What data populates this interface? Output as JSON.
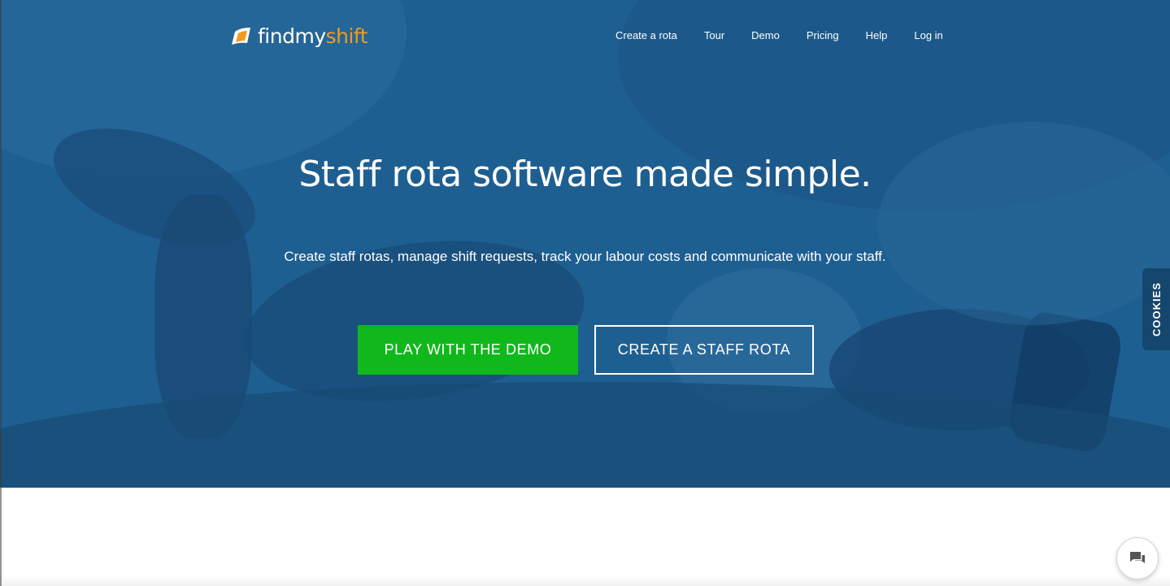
{
  "brand": {
    "name_part1": "findmy",
    "name_part2": "shift",
    "icon": "findmyshift-logo-icon",
    "colors": {
      "primary": "#ffffff",
      "accent": "#f39a1e"
    }
  },
  "nav": {
    "items": [
      {
        "label": "Create a rota"
      },
      {
        "label": "Tour"
      },
      {
        "label": "Demo"
      },
      {
        "label": "Pricing"
      },
      {
        "label": "Help"
      },
      {
        "label": "Log in"
      }
    ]
  },
  "hero": {
    "title": "Staff rota software made simple.",
    "subtitle": "Create staff rotas, manage shift requests, track your labour costs and communicate with your staff.",
    "primary_button": "PLAY WITH THE DEMO",
    "secondary_button": "CREATE A STAFF ROTA",
    "colors": {
      "background": "#1e5f91",
      "primary_button": "#10b81c"
    }
  },
  "cookies_tab": {
    "label": "COOKIES",
    "color": "#15466d"
  },
  "chat": {
    "icon": "chat-bubble-icon"
  }
}
